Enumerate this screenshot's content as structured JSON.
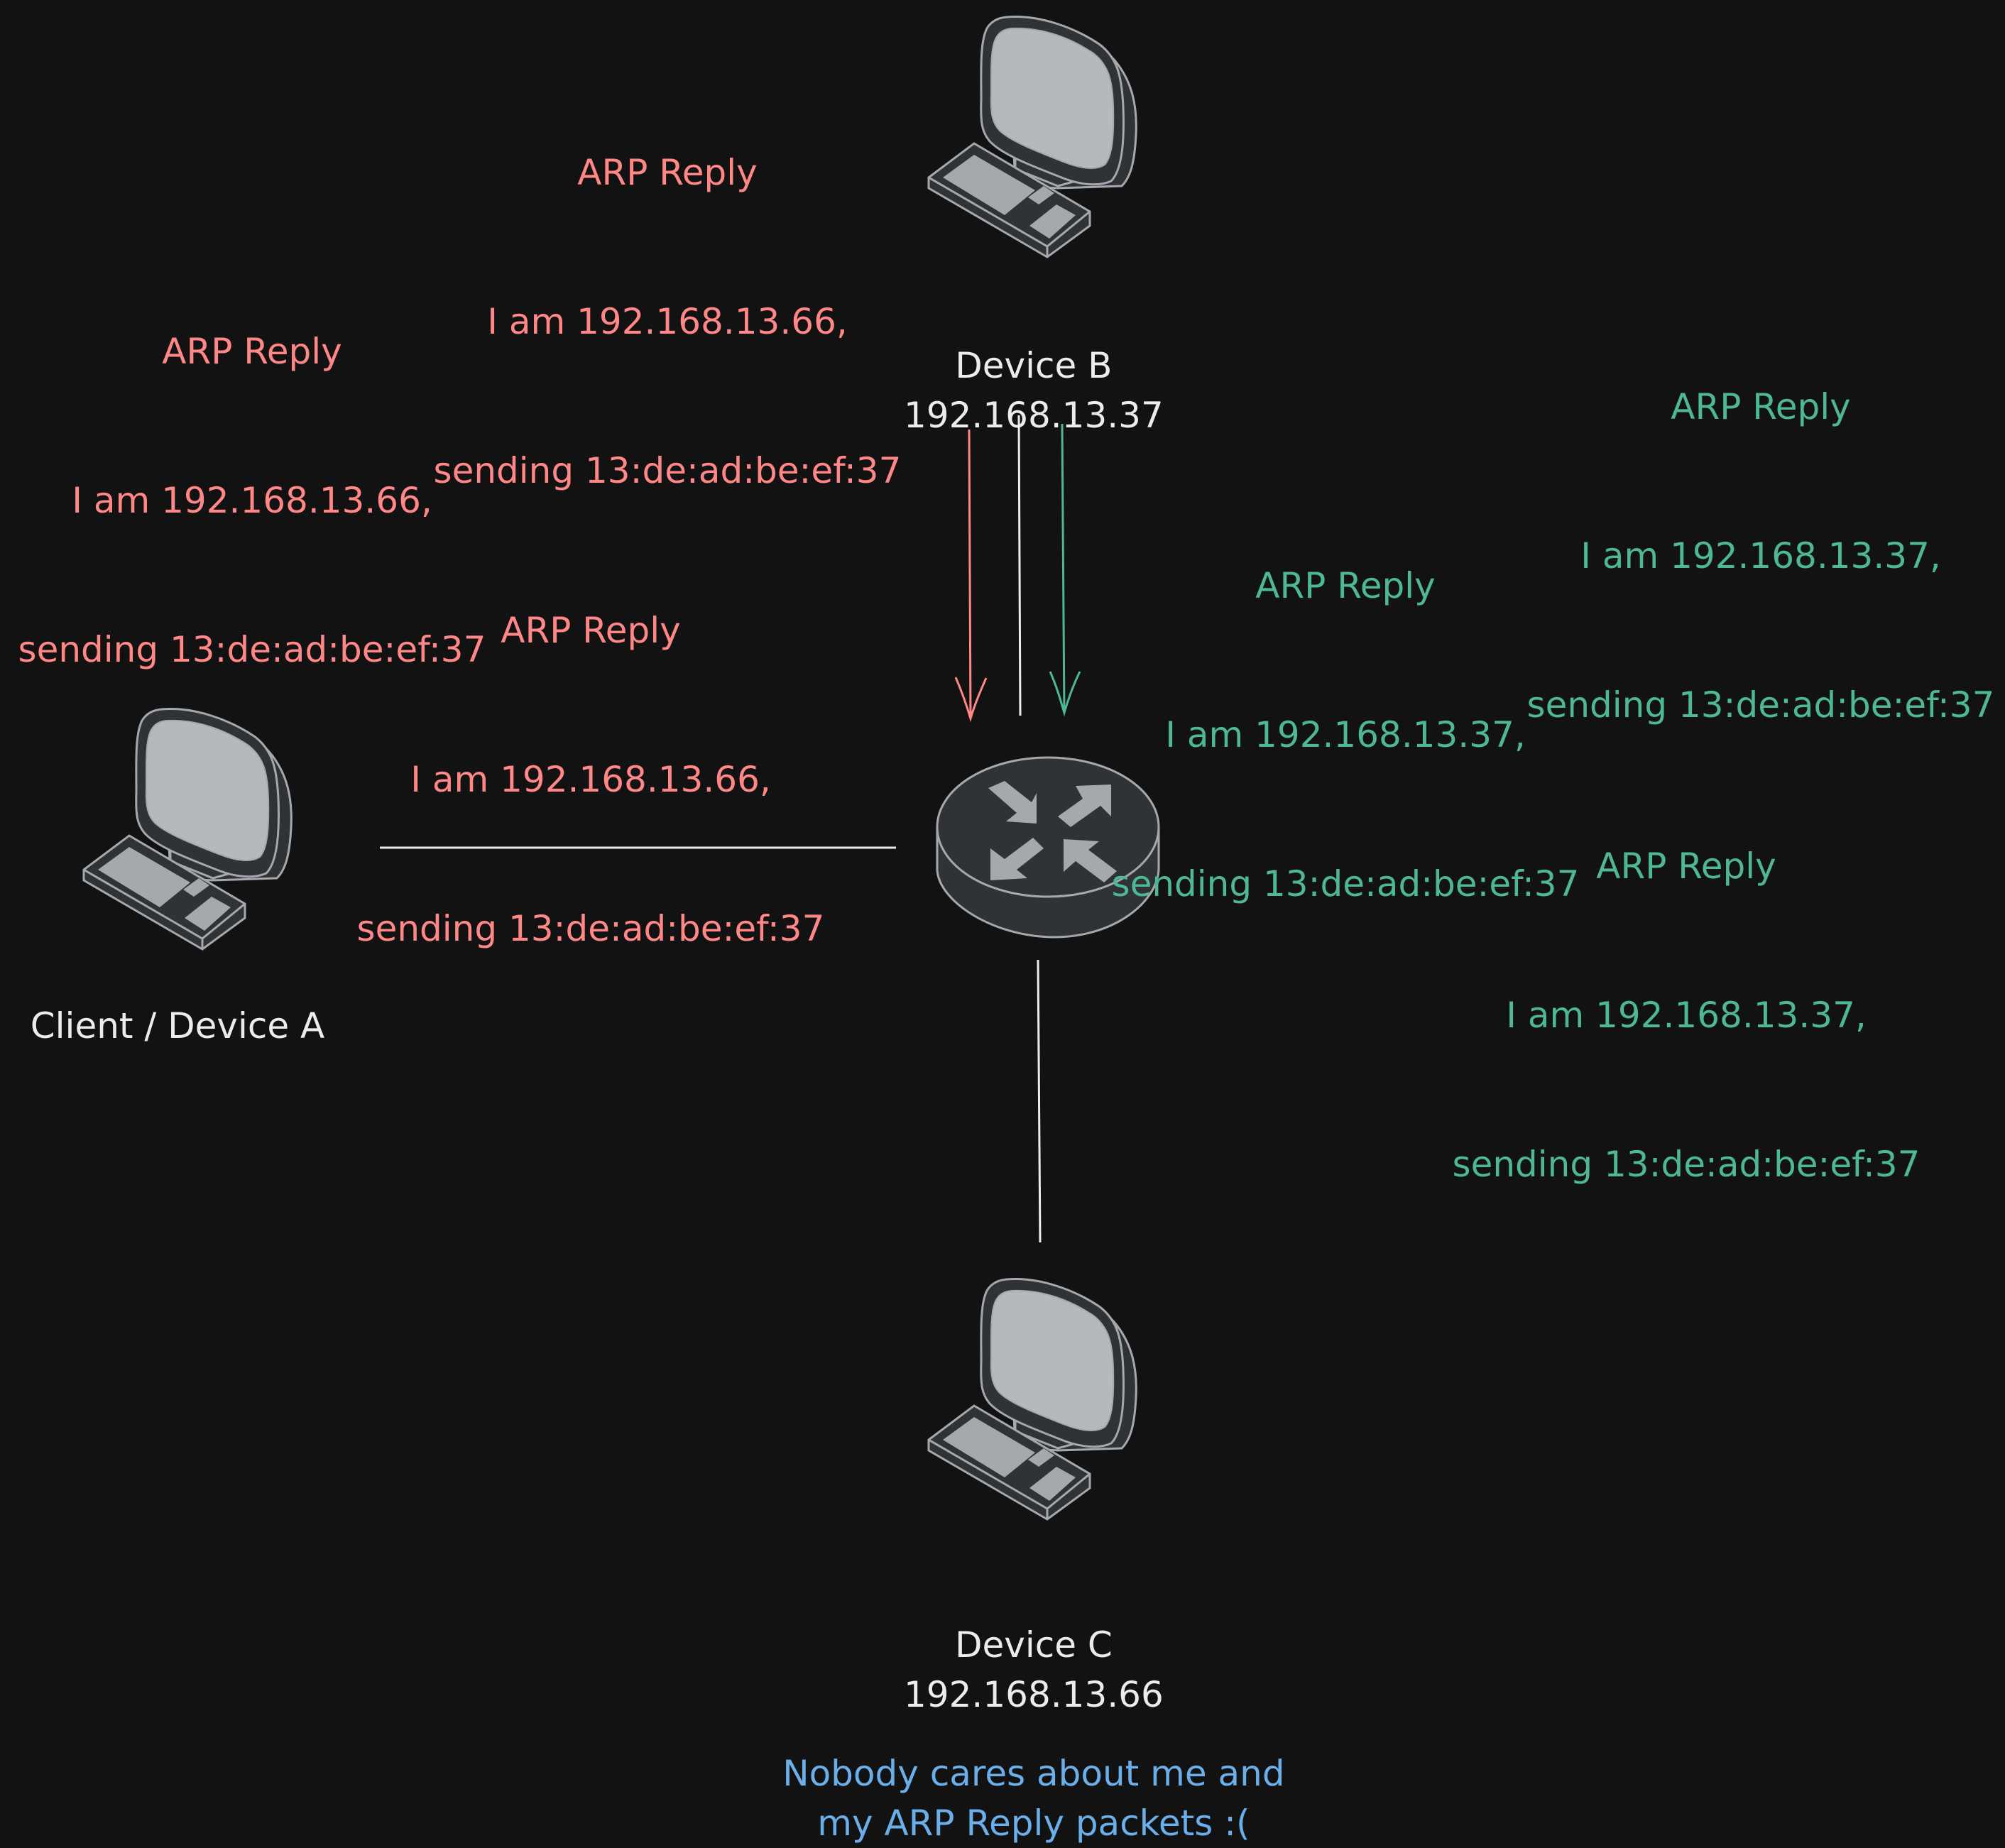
{
  "diagram": {
    "colors": {
      "background": "#121212",
      "spoofed_reply": "#ff8787",
      "legit_reply": "#4db893",
      "label": "#ececec",
      "comment": "#6aaeea",
      "device_fill": "#2f3336",
      "device_screen": "#b5b9bd",
      "device_stroke": "#a5a9ae"
    },
    "nodes": {
      "device_a": {
        "label": "Client / Device A",
        "icon": "desktop-computer-icon"
      },
      "device_b": {
        "name": "Device B",
        "ip": "192.168.13.37",
        "icon": "desktop-computer-icon"
      },
      "device_c": {
        "name": "Device C",
        "ip": "192.168.13.66",
        "icon": "desktop-computer-icon"
      },
      "router": {
        "icon": "router-icon"
      }
    },
    "spoofed_replies": [
      {
        "title": "ARP Reply",
        "line1": "I am 192.168.13.66,",
        "line2": "sending 13:de:ad:be:ef:37"
      },
      {
        "title": "ARP Reply",
        "line1": "I am 192.168.13.66,",
        "line2": "sending 13:de:ad:be:ef:37"
      },
      {
        "title": "ARP Reply",
        "line1": "I am 192.168.13.66,",
        "line2": "sending 13:de:ad:be:ef:37"
      }
    ],
    "legit_replies": [
      {
        "title": "ARP Reply",
        "line1": "I am 192.168.13.37,",
        "line2": "sending 13:de:ad:be:ef:37"
      },
      {
        "title": "ARP Reply",
        "line1": "I am 192.168.13.37,",
        "line2": "sending 13:de:ad:be:ef:37"
      },
      {
        "title": "ARP Reply",
        "line1": "I am 192.168.13.37,",
        "line2": "sending 13:de:ad:be:ef:37"
      }
    ],
    "comment": {
      "line1": "Nobody cares about me and",
      "line2": "my ARP Reply packets :("
    },
    "edges": [
      {
        "from": "device_a",
        "to": "router",
        "style": "line"
      },
      {
        "from": "device_b",
        "to": "router",
        "style": "line"
      },
      {
        "from": "router",
        "to": "device_c",
        "style": "line"
      },
      {
        "from": "device_b",
        "to": "router",
        "style": "arrow",
        "color": "spoofed_reply"
      },
      {
        "from": "device_b",
        "to": "router",
        "style": "arrow",
        "color": "legit_reply"
      }
    ]
  }
}
